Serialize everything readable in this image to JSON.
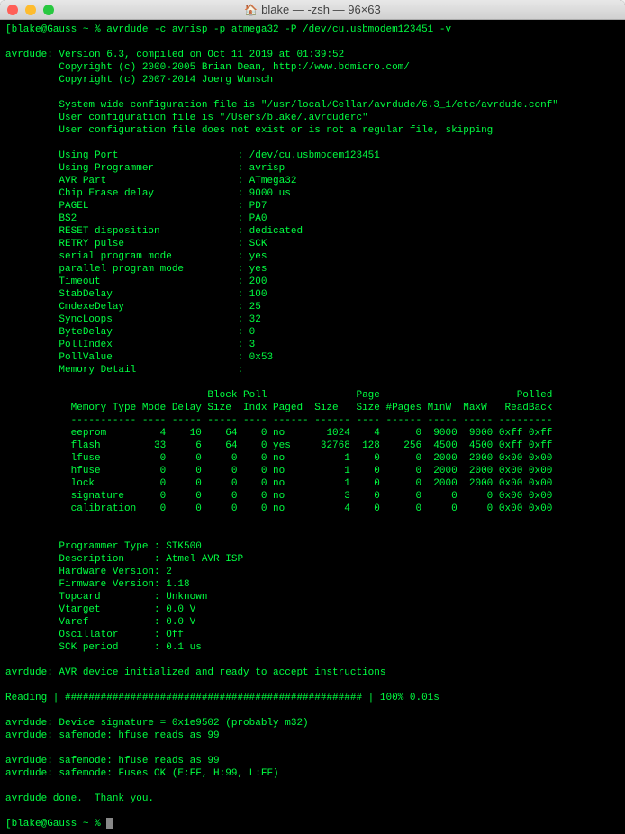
{
  "window": {
    "title": "blake — -zsh — 96×63"
  },
  "prompt1": "[blake@Gauss ~ % ",
  "command": "avrdude -c avrisp -p atmega32 -P /dev/cu.usbmodem123451 -v",
  "header": {
    "line1": "avrdude: Version 6.3, compiled on Oct 11 2019 at 01:39:52",
    "line2": "         Copyright (c) 2000-2005 Brian Dean, http://www.bdmicro.com/",
    "line3": "         Copyright (c) 2007-2014 Joerg Wunsch",
    "line4": "         System wide configuration file is \"/usr/local/Cellar/avrdude/6.3_1/etc/avrdude.conf\"",
    "line5": "         User configuration file is \"/Users/blake/.avrduderc\"",
    "line6": "         User configuration file does not exist or is not a regular file, skipping"
  },
  "settings": [
    {
      "k": "Using Port",
      "v": "/dev/cu.usbmodem123451"
    },
    {
      "k": "Using Programmer",
      "v": "avrisp"
    },
    {
      "k": "AVR Part",
      "v": "ATmega32"
    },
    {
      "k": "Chip Erase delay",
      "v": "9000 us"
    },
    {
      "k": "PAGEL",
      "v": "PD7"
    },
    {
      "k": "BS2",
      "v": "PA0"
    },
    {
      "k": "RESET disposition",
      "v": "dedicated"
    },
    {
      "k": "RETRY pulse",
      "v": "SCK"
    },
    {
      "k": "serial program mode",
      "v": "yes"
    },
    {
      "k": "parallel program mode",
      "v": "yes"
    },
    {
      "k": "Timeout",
      "v": "200"
    },
    {
      "k": "StabDelay",
      "v": "100"
    },
    {
      "k": "CmdexeDelay",
      "v": "25"
    },
    {
      "k": "SyncLoops",
      "v": "32"
    },
    {
      "k": "ByteDelay",
      "v": "0"
    },
    {
      "k": "PollIndex",
      "v": "3"
    },
    {
      "k": "PollValue",
      "v": "0x53"
    },
    {
      "k": "Memory Detail",
      "v": ""
    }
  ],
  "table": {
    "hdr1": "                                  Block Poll               Page                       Polled",
    "hdr2": "           Memory Type Mode Delay Size  Indx Paged  Size   Size #Pages MinW  MaxW   ReadBack",
    "sep": "           ----------- ---- ----- ----- ---- ------ ------ ---- ------ ----- ----- ---------",
    "rows": [
      "           eeprom         4    10    64    0 no       1024    4      0  9000  9000 0xff 0xff",
      "           flash         33     6    64    0 yes     32768  128    256  4500  4500 0xff 0xff",
      "           lfuse          0     0     0    0 no          1    0      0  2000  2000 0x00 0x00",
      "           hfuse          0     0     0    0 no          1    0      0  2000  2000 0x00 0x00",
      "           lock           0     0     0    0 no          1    0      0  2000  2000 0x00 0x00",
      "           signature      0     0     0    0 no          3    0      0     0     0 0x00 0x00",
      "           calibration    0     0     0    0 no          4    0      0     0     0 0x00 0x00"
    ]
  },
  "prog": [
    {
      "k": "Programmer Type",
      "v": "STK500"
    },
    {
      "k": "Description",
      "v": "Atmel AVR ISP"
    },
    {
      "k": "Hardware Version",
      "v": "2"
    },
    {
      "k": "Firmware Version",
      "v": "1.18"
    },
    {
      "k": "Topcard",
      "v": "Unknown"
    },
    {
      "k": "Vtarget",
      "v": "0.0 V"
    },
    {
      "k": "Varef",
      "v": "0.0 V"
    },
    {
      "k": "Oscillator",
      "v": "Off"
    },
    {
      "k": "SCK period",
      "v": "0.1 us"
    }
  ],
  "footer": {
    "l1": "avrdude: AVR device initialized and ready to accept instructions",
    "l2": "Reading | ################################################## | 100% 0.01s",
    "l3": "avrdude: Device signature = 0x1e9502 (probably m32)",
    "l4": "avrdude: safemode: hfuse reads as 99",
    "l5": "avrdude: safemode: hfuse reads as 99",
    "l6": "avrdude: safemode: Fuses OK (E:FF, H:99, L:FF)",
    "l7": "avrdude done.  Thank you."
  },
  "prompt2": "[blake@Gauss ~ % "
}
